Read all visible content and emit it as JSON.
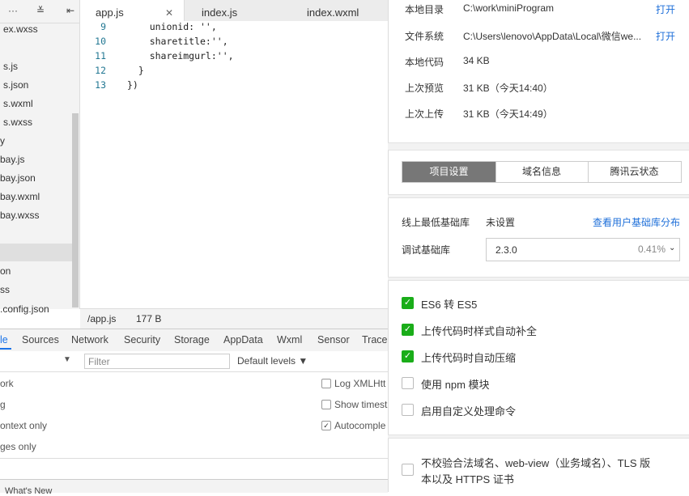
{
  "tree": {
    "toolbar": {
      "more_icon": "···",
      "collapse_icon": "≚",
      "expand_icon": "⇤"
    },
    "items": [
      "ex.wxss",
      "s.js",
      "s.json",
      "s.wxml",
      "s.wxss",
      "y",
      "bay.js",
      "bay.json",
      "bay.wxml",
      "bay.wxss",
      "",
      "on",
      "ss",
      ".config.json"
    ]
  },
  "tabs": {
    "tab1": "app.js",
    "tab2": "index.js",
    "tab3": "index.wxml",
    "close_icon": "✕"
  },
  "code": {
    "line_numbers": [
      "9",
      "10",
      "11",
      "12",
      "13"
    ],
    "lines": [
      "    unionid: '',",
      "    sharetitle:'',",
      "    shareimgurl:'',",
      "  }",
      "})"
    ]
  },
  "status_bar": {
    "path": "/app.js",
    "size": "177 B"
  },
  "devtools": {
    "tabs": [
      "le",
      "Sources",
      "Network",
      "Security",
      "Storage",
      "AppData",
      "Wxml",
      "Sensor",
      "Trace"
    ],
    "filter_placeholder": "Filter",
    "levels": "Default levels ▼",
    "dropdown_icon": "▼",
    "left_options": [
      "ork",
      "g",
      "ontext only",
      "ges only"
    ],
    "right_options": [
      "Log XMLHtt",
      "Show timest",
      "Autocomple"
    ],
    "drawer_label": "What's New"
  },
  "project": {
    "rows": [
      {
        "label": "本地目录",
        "value": "C:\\work\\miniProgram",
        "action": "打开"
      },
      {
        "label": "文件系统",
        "value": "C:\\Users\\lenovo\\AppData\\Local\\微信we...",
        "action": "打开"
      },
      {
        "label": "本地代码",
        "value": "34 KB"
      },
      {
        "label": "上次预览",
        "value": "31 KB（今天14:40）"
      },
      {
        "label": "上次上传",
        "value": "31 KB（今天14:49）"
      }
    ]
  },
  "segments": [
    "项目设置",
    "域名信息",
    "腾讯云状态"
  ],
  "settings": {
    "min_lib_label": "线上最低基础库",
    "min_lib_value": "未设置",
    "min_lib_link": "查看用户基础库分布",
    "debug_lib_label": "调试基础库",
    "debug_lib_value": "2.3.0",
    "debug_lib_pct": "0.41%"
  },
  "checks": [
    {
      "label": "ES6 转 ES5",
      "checked": true
    },
    {
      "label": "上传代码时样式自动补全",
      "checked": true
    },
    {
      "label": "上传代码时自动压缩",
      "checked": true
    },
    {
      "label": "使用 npm 模块",
      "checked": false
    },
    {
      "label": "启用自定义处理命令",
      "checked": false
    }
  ],
  "bottom_check": {
    "line1": "不校验合法域名、web-view（业务域名）、TLS 版",
    "line2": "本以及 HTTPS 证书",
    "checked": false
  },
  "colors": {
    "accent_green": "#1aad19",
    "link_blue": "#1e6fd9",
    "segment_active": "#777777"
  }
}
